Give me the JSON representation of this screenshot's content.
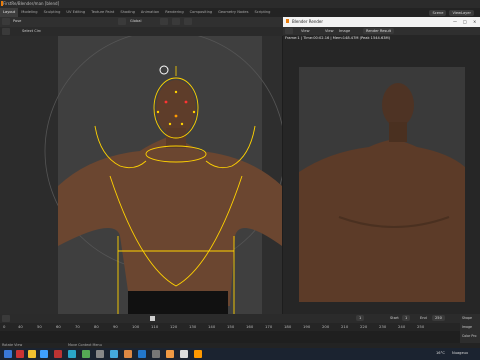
{
  "window": {
    "title": "FirstRe/Blender/man [blend]"
  },
  "workspace_tabs": [
    "Layout",
    "Modeling",
    "Sculpting",
    "UV Editing",
    "Texture Paint",
    "Shading",
    "Animation",
    "Rendering",
    "Compositing",
    "Geometry Nodes",
    "Scripting"
  ],
  "workspace_right": {
    "scene_label": "Scene",
    "viewlayer_label": "ViewLayer"
  },
  "viewport_toolbar": {
    "mode": "Pose",
    "select_label": "Select Circ",
    "transform_space": "Global"
  },
  "render_window": {
    "title": "Blender Render",
    "menu": [
      "View",
      "View",
      "Image"
    ],
    "slot": "Render Result",
    "info": "Frame:1 | Time:00:02.16 | Mem:148.47M (Peak 1544.63M)"
  },
  "timeline": {
    "ruler_ticks": [
      "0",
      "40",
      "50",
      "60",
      "70",
      "80",
      "90",
      "100",
      "110",
      "120",
      "130",
      "140",
      "150",
      "160",
      "170",
      "180",
      "190",
      "200",
      "210",
      "220",
      "230",
      "240",
      "250"
    ],
    "current_frame": "1",
    "start_label": "Start",
    "start_value": "1",
    "end_label": "End",
    "end_value": "250"
  },
  "side_panel": {
    "items": [
      "Shape",
      "Image",
      "Color Pro"
    ]
  },
  "status_bar": {
    "left": "Rotate View",
    "right": "Move Context Menu"
  },
  "taskbar": {
    "weather": "16°C",
    "weather_desc": "Nuageux"
  },
  "colors": {
    "armature": "#ffd200",
    "accent": "#ff9900",
    "skin": "#6b4630"
  }
}
